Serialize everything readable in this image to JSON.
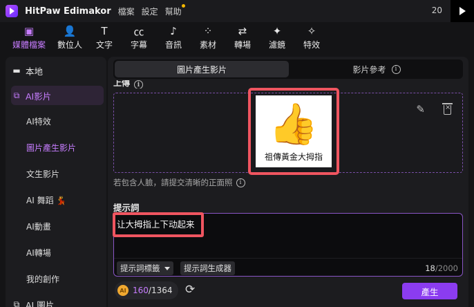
{
  "titlebar": {
    "app_title": "HitPaw Edimakor",
    "menu": [
      "檔案",
      "設定",
      "幫助"
    ],
    "right_text": "20"
  },
  "toolbar": {
    "items": [
      {
        "label": "媒體檔案",
        "icon": "media-icon",
        "glyph": "▣",
        "active": true
      },
      {
        "label": "數位人",
        "icon": "avatar-add-icon",
        "glyph": "👤"
      },
      {
        "label": "文字",
        "icon": "text-icon",
        "glyph": "T"
      },
      {
        "label": "字幕",
        "icon": "caption-icon",
        "glyph": "㏄"
      },
      {
        "label": "音訊",
        "icon": "music-icon",
        "glyph": "♪"
      },
      {
        "label": "素材",
        "icon": "assets-icon",
        "glyph": "⁘"
      },
      {
        "label": "轉場",
        "icon": "transition-icon",
        "glyph": "⇄"
      },
      {
        "label": "濾鏡",
        "icon": "filter-icon",
        "glyph": "✦"
      },
      {
        "label": "特效",
        "icon": "effects-icon",
        "glyph": "✧"
      }
    ]
  },
  "sidebar": {
    "local": "本地",
    "ai_video": "AI影片",
    "subitems": [
      "AI特效",
      "圖片產生影片",
      "文生影片",
      "AI 舞蹈 💃",
      "AI動畫",
      "AI轉場",
      "我的創作"
    ],
    "ai_image": "AI 圖片"
  },
  "tabs": {
    "image_to_video": "圖片產生影片",
    "video_reference": "影片參考"
  },
  "upload": {
    "label": "上傳",
    "image_caption": "祖傳黃金大拇指",
    "hint": "若包含人臉，請提交清晰的正面照"
  },
  "prompt": {
    "label": "提示詞",
    "value": "让大拇指上下动起来",
    "tags_button": "提示詞標籤",
    "generator_button": "提示詞生成器",
    "count": "18",
    "max": "/2000"
  },
  "bottom": {
    "coin_label": "AI",
    "credits_used": "160",
    "credits_total": "/1364",
    "generate": "產生"
  },
  "colors": {
    "accent": "#c77dff",
    "generate": "#8b3cf0",
    "highlight_box": "#ef5560"
  }
}
